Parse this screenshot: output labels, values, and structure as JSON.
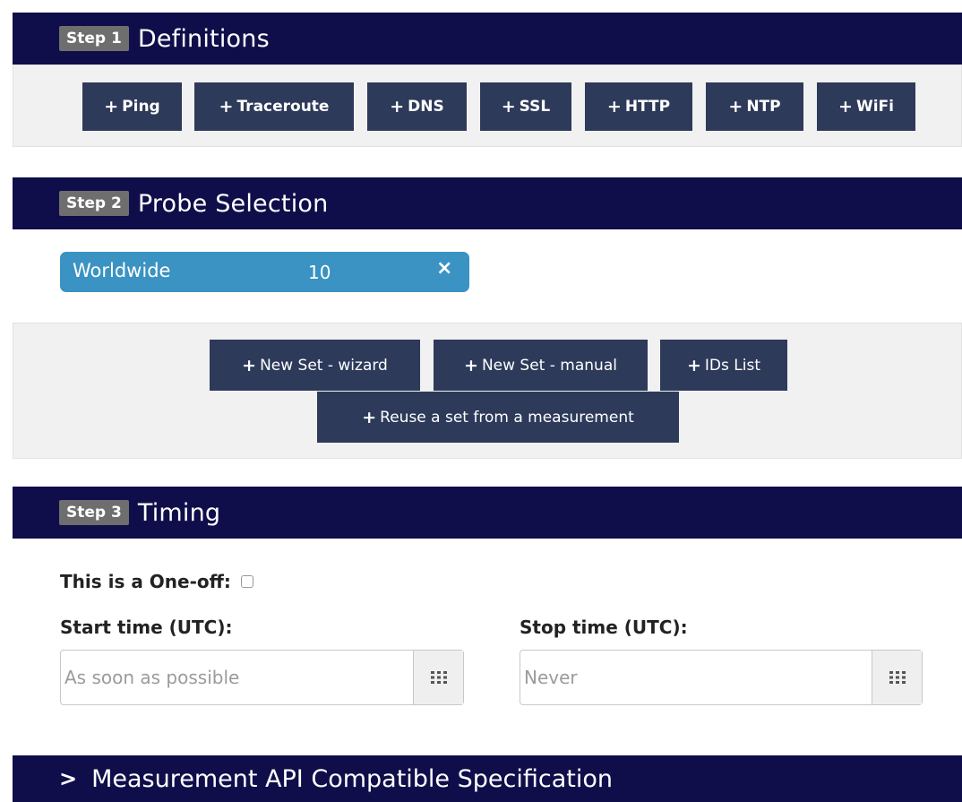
{
  "step1": {
    "badge": "Step 1",
    "title": "Definitions",
    "buttons": [
      {
        "plus": "+",
        "label": "Ping"
      },
      {
        "plus": "+",
        "label": "Traceroute"
      },
      {
        "plus": "+",
        "label": "DNS"
      },
      {
        "plus": "+",
        "label": "SSL"
      },
      {
        "plus": "+",
        "label": "HTTP"
      },
      {
        "plus": "+",
        "label": "NTP"
      },
      {
        "plus": "+",
        "label": "WiFi"
      }
    ]
  },
  "step2": {
    "badge": "Step 2",
    "title": "Probe Selection",
    "probe_set": {
      "label": "Worldwide",
      "count": "10",
      "remove": "×"
    },
    "buttons": [
      {
        "plus": "+",
        "label": "New Set - wizard"
      },
      {
        "plus": "+",
        "label": "New Set - manual"
      },
      {
        "plus": "+",
        "label": "IDs List"
      },
      {
        "plus": "+",
        "label": "Reuse a set from a measurement"
      }
    ]
  },
  "step3": {
    "badge": "Step 3",
    "title": "Timing",
    "one_off_label": "This is a One-off:",
    "start_label": "Start time (UTC):",
    "start_placeholder": "As soon as possible",
    "stop_label": "Stop time (UTC):",
    "stop_placeholder": "Never"
  },
  "api_section": {
    "chevron": ">",
    "title": "Measurement API Compatible Specification"
  },
  "colors": {
    "header_bg": "#0f0e4a",
    "button_bg": "#2d3a5a",
    "badge_bg": "#6e6e6e",
    "chip_bg": "#3a93c2"
  }
}
